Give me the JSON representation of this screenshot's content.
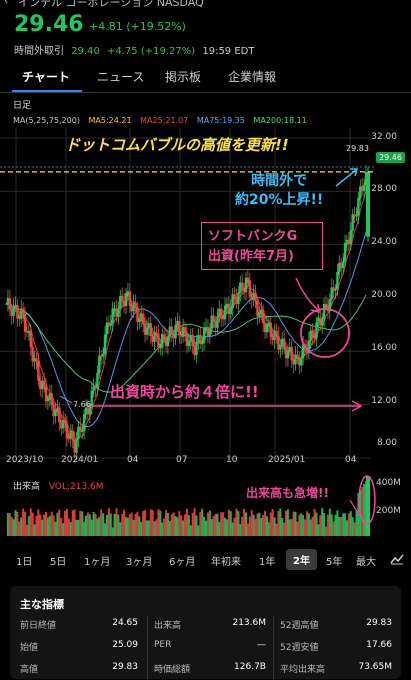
{
  "header": {
    "company": "インテル コーポレーション NASDAQ",
    "price": "29.46",
    "change": "+4.81 (+19.52%)",
    "after_hours_label": "時間外取引",
    "after_hours_price": "29.40",
    "after_hours_change": "+4.75 (+19.27%)",
    "after_hours_time": "19:59 EDT"
  },
  "tabs": [
    {
      "label": "チャート",
      "active": true
    },
    {
      "label": "ニュース",
      "active": false
    },
    {
      "label": "掲示板",
      "active": false
    },
    {
      "label": "企業情報",
      "active": false
    }
  ],
  "chart": {
    "period": "日足",
    "ma_label": "MA(5,25,75,200)",
    "ma_values": [
      {
        "label": "MA5:24.21",
        "color": "#facc15"
      },
      {
        "label": "MA25:21.07",
        "color": "#ef4444"
      },
      {
        "label": "MA75:19.35",
        "color": "#60a5fa"
      },
      {
        "label": "MA200:18.11",
        "color": "#4ade80"
      }
    ],
    "y_ticks": [
      "32.00",
      "28.00",
      "24.00",
      "20.00",
      "16.00",
      "12.00",
      "8.00"
    ],
    "x_ticks": [
      "2023/10",
      "2024/01",
      "04",
      "07",
      "10",
      "2025/01",
      "04"
    ],
    "high_label": "29.83",
    "current_label": "29.46",
    "low_label": "7.66",
    "annotations": {
      "dotcom": "ドットコムバブルの高値を更新!!",
      "after_hours": "時間外で\n約20%上昇!!",
      "softbank": "ソフトバンクG\n出資(昨年7月)",
      "four_x": "出資時から約４倍に!!",
      "volume": "出来高も急増!!"
    },
    "colors": {
      "up": "#22c55e",
      "down": "#ef4444",
      "annotation": "#ec4899",
      "arrow": "#38bdf8"
    }
  },
  "volume": {
    "label": "出来高",
    "value": "VOL:213.6M",
    "ticks": [
      "400M",
      "200M"
    ]
  },
  "chart_data": {
    "type": "candlestick",
    "x_ticks": [
      "2023/10",
      "2024/01",
      "04",
      "07",
      "10",
      "2025/01",
      "04"
    ],
    "ylim": [
      8,
      32
    ],
    "close_path": [
      {
        "x": "2023/08",
        "y": 19.5
      },
      {
        "x": "2023/09",
        "y": 18.6
      },
      {
        "x": "2023/10",
        "y": 13.6
      },
      {
        "x": "2023/11",
        "y": 11.2
      },
      {
        "x": "2023/12",
        "y": 9.0
      },
      {
        "x": "2024/01",
        "y": 12.5
      },
      {
        "x": "2024/02",
        "y": 18.3
      },
      {
        "x": "2024/03",
        "y": 20.2
      },
      {
        "x": "2024/04",
        "y": 18.0
      },
      {
        "x": "2024/05",
        "y": 16.6
      },
      {
        "x": "2024/06",
        "y": 17.8
      },
      {
        "x": "2024/07",
        "y": 16.3
      },
      {
        "x": "2024/08",
        "y": 18.1
      },
      {
        "x": "2024/09",
        "y": 19.3
      },
      {
        "x": "2024/10",
        "y": 21.2
      },
      {
        "x": "2024/11",
        "y": 18.2
      },
      {
        "x": "2024/12",
        "y": 16.5
      },
      {
        "x": "2025/01",
        "y": 15.2
      },
      {
        "x": "2025/02",
        "y": 17.5
      },
      {
        "x": "2025/03",
        "y": 20.2
      },
      {
        "x": "2025/04",
        "y": 24.6
      },
      {
        "x": "2025/04+",
        "y": 29.46
      }
    ],
    "high": 29.83,
    "low": 7.66,
    "last": 29.46
  },
  "range": {
    "options": [
      "1日",
      "5日",
      "1ヶ月",
      "3ヶ月",
      "6ヶ月",
      "年初来",
      "1年",
      "2年",
      "5年",
      "最大"
    ],
    "selected": "2年"
  },
  "stats": {
    "title": "主な指標",
    "rows": [
      [
        "前日終値",
        "24.65",
        "出来高",
        "213.6M",
        "52週高値",
        "29.83"
      ],
      [
        "始値",
        "25.09",
        "PER",
        "—",
        "52週安値",
        "17.66"
      ],
      [
        "高値",
        "29.83",
        "時価総額",
        "126.7B",
        "平均出来高",
        "73.65M"
      ]
    ]
  }
}
